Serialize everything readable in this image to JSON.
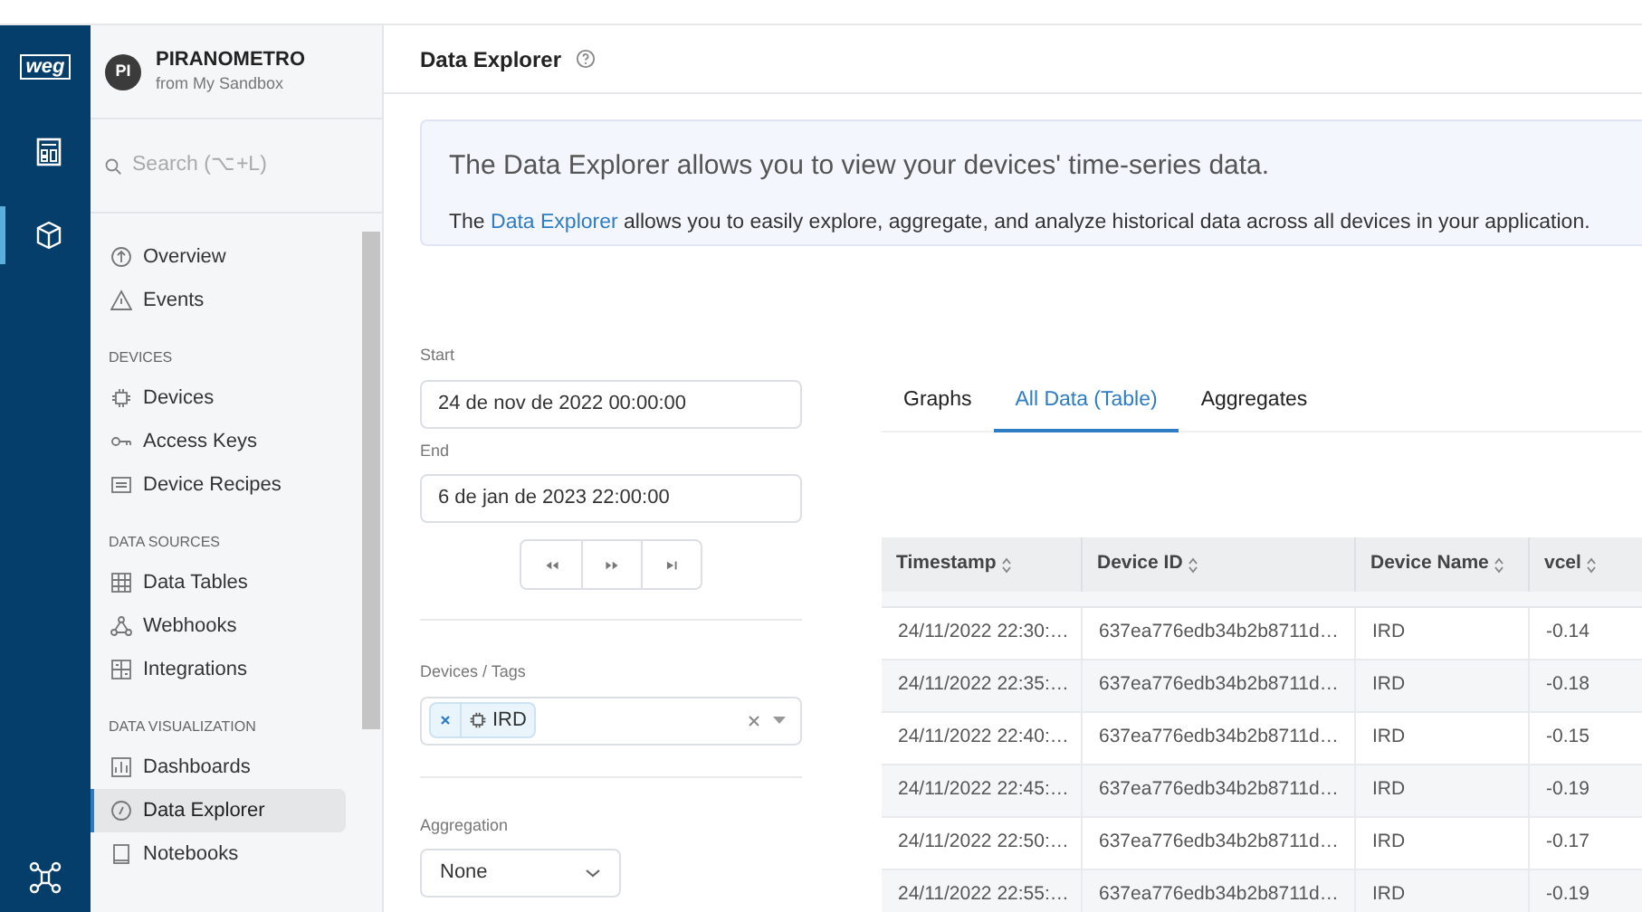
{
  "rail": {
    "logo": "weg",
    "items": [
      {
        "selected": false
      },
      {
        "selected": true
      }
    ]
  },
  "app": {
    "avatar": "PI",
    "name": "PIRANOMETRO",
    "subtitle": "from My Sandbox"
  },
  "search": {
    "placeholder": "Search (⌥+L)"
  },
  "nav": [
    {
      "items": [
        {
          "label": "Overview",
          "selected": false
        },
        {
          "label": "Events",
          "selected": false
        }
      ]
    },
    {
      "title": "DEVICES",
      "items": [
        {
          "label": "Devices",
          "selected": false
        },
        {
          "label": "Access Keys",
          "selected": false
        },
        {
          "label": "Device Recipes",
          "selected": false
        }
      ]
    },
    {
      "title": "DATA SOURCES",
      "items": [
        {
          "label": "Data Tables",
          "selected": false
        },
        {
          "label": "Webhooks",
          "selected": false
        },
        {
          "label": "Integrations",
          "selected": false
        }
      ]
    },
    {
      "title": "DATA VISUALIZATION",
      "items": [
        {
          "label": "Dashboards",
          "selected": false
        },
        {
          "label": "Data Explorer",
          "selected": true
        },
        {
          "label": "Notebooks",
          "selected": false
        }
      ]
    }
  ],
  "page_title": "Data Explorer",
  "info": {
    "heading": "The Data Explorer allows you to view your devices' time-series data.",
    "before": "The ",
    "link": "Data Explorer",
    "after": " allows you to easily explore, aggregate, and analyze historical data across all devices in your application."
  },
  "start": {
    "label": "Start",
    "value": "24 de nov de 2022 00:00:00"
  },
  "end": {
    "label": "End",
    "value": "6 de jan de 2023 22:00:00"
  },
  "devices": {
    "label": "Devices / Tags",
    "tags": [
      "IRD"
    ]
  },
  "aggregation": {
    "label": "Aggregation",
    "value": "None"
  },
  "tabs": [
    {
      "label": "Graphs",
      "selected": false
    },
    {
      "label": "All Data (Table)",
      "selected": true
    },
    {
      "label": "Aggregates",
      "selected": false
    }
  ],
  "table": {
    "columns": [
      "Timestamp",
      "Device ID",
      "Device Name",
      "vcel"
    ],
    "rows": [
      [
        "24/11/2022 22:30:…",
        "637ea776edb34b2b8711d…",
        "IRD",
        "-0.14"
      ],
      [
        "24/11/2022 22:35:…",
        "637ea776edb34b2b8711d…",
        "IRD",
        "-0.18"
      ],
      [
        "24/11/2022 22:40:…",
        "637ea776edb34b2b8711d…",
        "IRD",
        "-0.15"
      ],
      [
        "24/11/2022 22:45:…",
        "637ea776edb34b2b8711d…",
        "IRD",
        "-0.19"
      ],
      [
        "24/11/2022 22:50:…",
        "637ea776edb34b2b8711d…",
        "IRD",
        "-0.17"
      ],
      [
        "24/11/2022 22:55:…",
        "637ea776edb34b2b8711d…",
        "IRD",
        "-0.19"
      ]
    ]
  }
}
